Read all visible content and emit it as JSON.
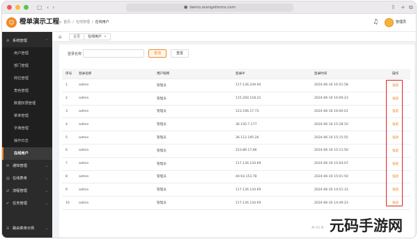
{
  "browser": {
    "url": "demo.orangeforms.com"
  },
  "app": {
    "title": "橙单演示工程",
    "logo": "☺"
  },
  "header_breadcrumb": {
    "home": "首页",
    "section": "在线管理",
    "page": "在线用户"
  },
  "user": {
    "name": "管理员"
  },
  "tabs": {
    "home_icon": "⌂",
    "items": [
      {
        "label": "主页"
      },
      {
        "label": "在线用户"
      }
    ]
  },
  "sidebar": {
    "groups": [
      {
        "label": "系统管理",
        "icon": "⚙"
      },
      {
        "label": "通知管理",
        "icon": "✉"
      },
      {
        "label": "在线表单",
        "icon": "▤"
      },
      {
        "label": "流程管理",
        "icon": "⇄"
      },
      {
        "label": "任务管理",
        "icon": "✔"
      },
      {
        "label": "路由菜单示例",
        "icon": "☰"
      }
    ],
    "items": [
      {
        "label": "用户管理"
      },
      {
        "label": "部门管理"
      },
      {
        "label": "岗位管理"
      },
      {
        "label": "角色管理"
      },
      {
        "label": "数据权限管理"
      },
      {
        "label": "菜单管理"
      },
      {
        "label": "字典管理"
      },
      {
        "label": "操作日志"
      },
      {
        "label": "在线用户"
      }
    ]
  },
  "search": {
    "label": "登录名称",
    "value": "",
    "search_button": "查询",
    "reset_button": "重置"
  },
  "table": {
    "columns": [
      "序号",
      "登录名称",
      "用户昵称",
      "登录IP",
      "登录时间",
      "操作"
    ],
    "action_label": "强退",
    "rows": [
      {
        "no": "1",
        "login": "admin",
        "nick": "管理员",
        "ip": "117.136.239.94",
        "time": "2024-06-16 16:51:58"
      },
      {
        "no": "2",
        "login": "admin",
        "nick": "管理员",
        "ip": "115.200.118.22",
        "time": "2024-06-16 16:09:23"
      },
      {
        "no": "3",
        "login": "admin",
        "nick": "管理员",
        "ip": "123.196.17.73",
        "time": "2024-06-16 16:00:01"
      },
      {
        "no": "4",
        "login": "admin",
        "nick": "管理员",
        "ip": "36.150.7.177",
        "time": "2024-06-16 15:28:10"
      },
      {
        "no": "5",
        "login": "admin",
        "nick": "管理员",
        "ip": "36.112.195.26",
        "time": "2024-06-16 15:15:55"
      },
      {
        "no": "6",
        "login": "admin",
        "nick": "管理员",
        "ip": "223.89.17.86",
        "time": "2024-06-16 15:11:50"
      },
      {
        "no": "7",
        "login": "admin",
        "nick": "管理员",
        "ip": "117.136.134.69",
        "time": "2024-06-16 15:04:07"
      },
      {
        "no": "8",
        "login": "admin",
        "nick": "管理员",
        "ip": "49.93.153.78",
        "time": "2024-06-16 15:01:50"
      },
      {
        "no": "9",
        "login": "admin",
        "nick": "管理员",
        "ip": "117.136.134.69",
        "time": "2024-06-16 14:51:33"
      },
      {
        "no": "10",
        "login": "admin",
        "nick": "管理员",
        "ip": "117.136.134.69",
        "time": "2024-06-16 14:49:23"
      }
    ]
  },
  "pager": {
    "text": "共 93 条"
  },
  "watermark": "元码手游网",
  "colors": {
    "accent": "#f08a24",
    "sidebar_bg": "#2b2b2b",
    "highlight": "#e02020"
  }
}
